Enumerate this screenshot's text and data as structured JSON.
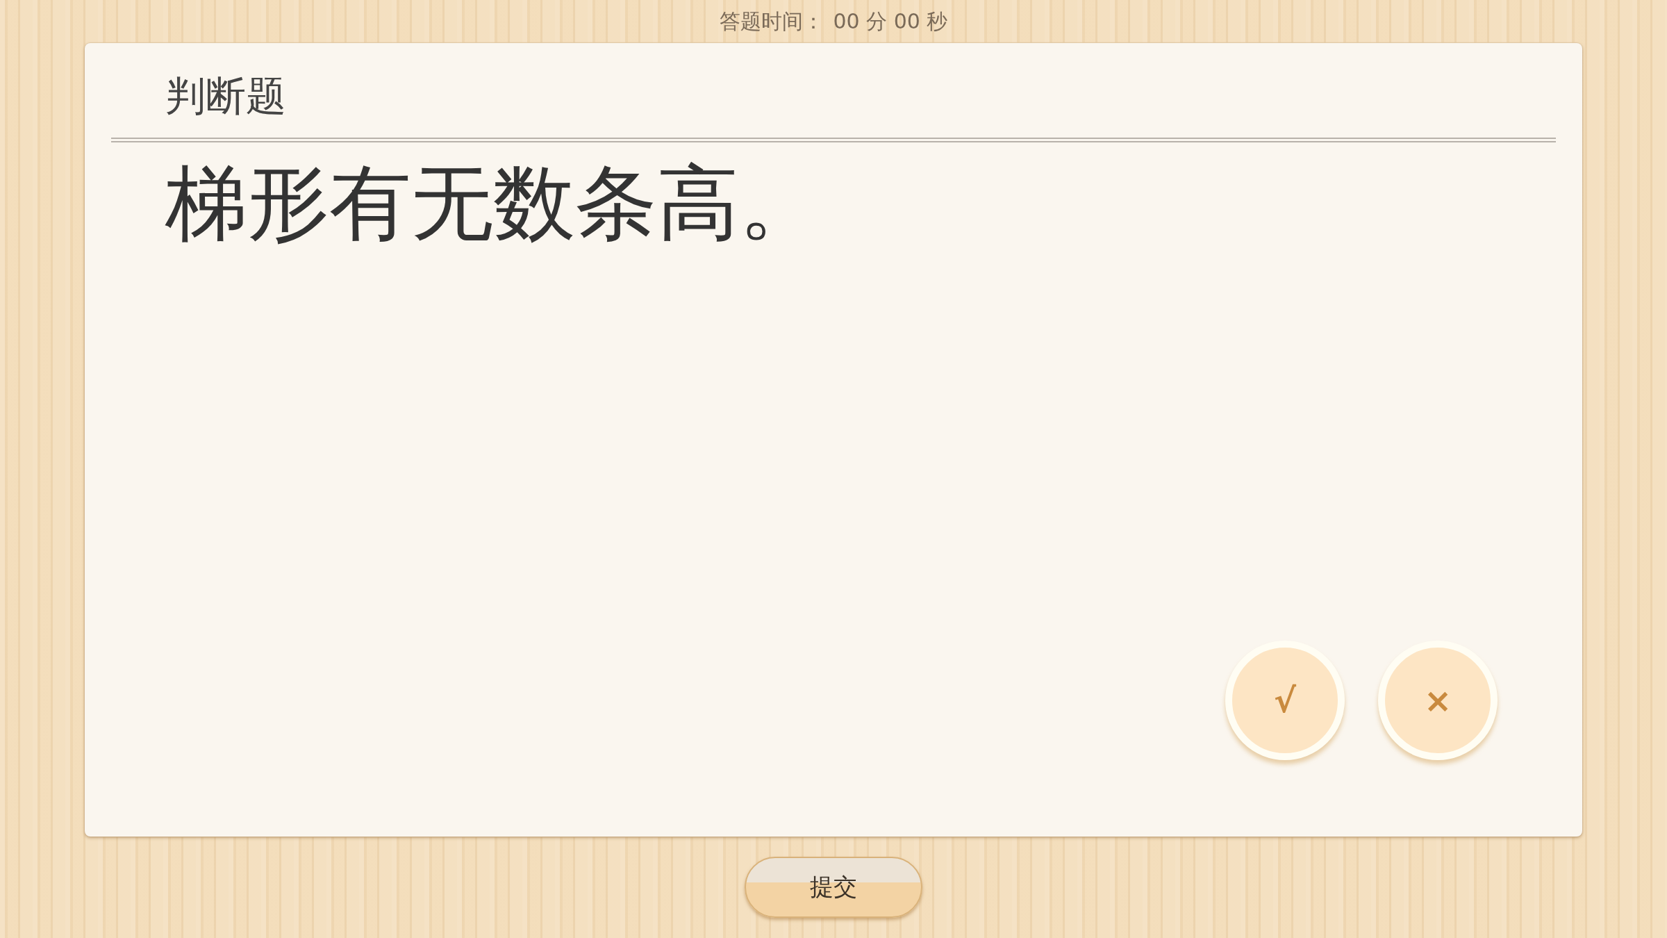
{
  "timer": {
    "label": "答题时间：",
    "minutes": "00",
    "minutes_unit": "分",
    "seconds": "00",
    "seconds_unit": "秒"
  },
  "question": {
    "type": "判断题",
    "text": "梯形有无数条高。"
  },
  "answers": [
    {
      "label": "√",
      "selected": false
    },
    {
      "label": "×",
      "selected": false
    }
  ],
  "submit": {
    "label": "提交"
  }
}
